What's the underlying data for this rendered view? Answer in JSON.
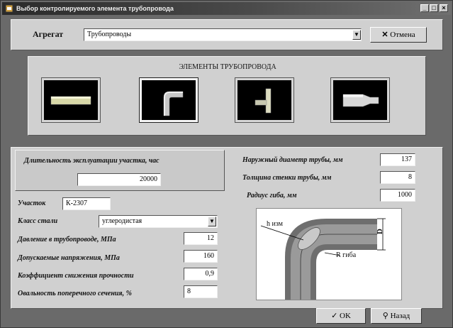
{
  "window": {
    "title": "Выбор контролируемого элемента трубопровода",
    "buttons": [
      "_",
      "□",
      "×"
    ]
  },
  "header": {
    "agregat_label": "Агрегат",
    "agregat_value": "Трубопроводы",
    "cancel_label": "Отмена"
  },
  "elements": {
    "title": "ЭЛЕМЕНТЫ  ТРУБОПРОВОДА",
    "items": [
      "straight-pipe",
      "elbow",
      "tee",
      "reducer"
    ],
    "selected": "elbow"
  },
  "form": {
    "duration_label": "Длительность эксплуатации участка, час",
    "duration_value": "20000",
    "section_label": "Участок",
    "section_value": "К-2307",
    "steel_label": "Класс стали",
    "steel_value": "углеродистая",
    "pressure_label": "Давление в трубопроводе, МПа",
    "pressure_value": "12",
    "stress_label": "Допускаемые напряжения, МПа",
    "stress_value": "160",
    "strength_label": "Коэффициент снижения прочности",
    "strength_value": "0,9",
    "ovality_label": "Овальность поперечного сечения, %",
    "ovality_value": "8"
  },
  "geometry": {
    "diameter_label": "Наружный диаметр трубы, мм",
    "diameter_value": "137",
    "thickness_label": "Толщина стенки трубы, мм",
    "thickness_value": "8",
    "radius_label": "Радиус гиба, мм",
    "radius_value": "1000"
  },
  "diagram": {
    "h_label": "h изм",
    "d_label": "D",
    "r_label": "R гиба"
  },
  "footer": {
    "ok_label": "OK",
    "back_label": "Назад"
  },
  "colors": {
    "panel": "#d0d0d0",
    "tile_bg": "#000000",
    "window_bg": "#6a6a6a"
  }
}
